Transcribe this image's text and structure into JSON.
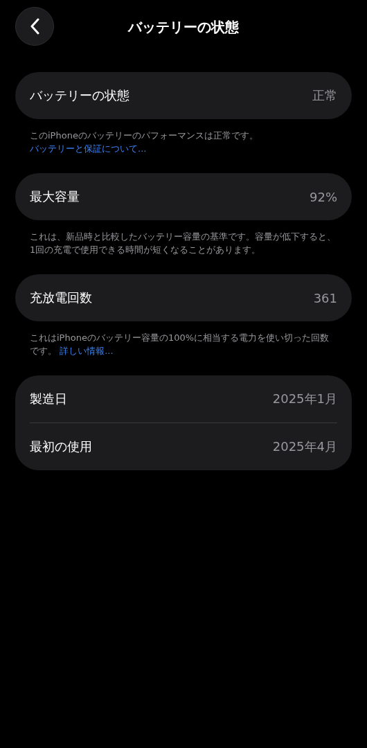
{
  "header": {
    "title": "バッテリーの状態"
  },
  "sections": [
    {
      "rows": [
        {
          "label": "バッテリーの状態",
          "value": "正常"
        }
      ],
      "footer": {
        "text": "このiPhoneのバッテリーのパフォーマンスは正常です。",
        "link": "バッテリーと保証について..."
      }
    },
    {
      "rows": [
        {
          "label": "最大容量",
          "value": "92%"
        }
      ],
      "footer": {
        "text": "これは、新品時と比較したバッテリー容量の基準です。容量が低下すると、1回の充電で使用できる時間が短くなることがあります。"
      }
    },
    {
      "rows": [
        {
          "label": "充放電回数",
          "value": "361"
        }
      ],
      "footer": {
        "text": "これはiPhoneのバッテリー容量の100%に相当する電力を使い切った回数です。",
        "link": "詳しい情報..."
      }
    },
    {
      "rows": [
        {
          "label": "製造日",
          "value": "2025年1月"
        },
        {
          "label": "最初の使用",
          "value": "2025年4月"
        }
      ]
    }
  ]
}
